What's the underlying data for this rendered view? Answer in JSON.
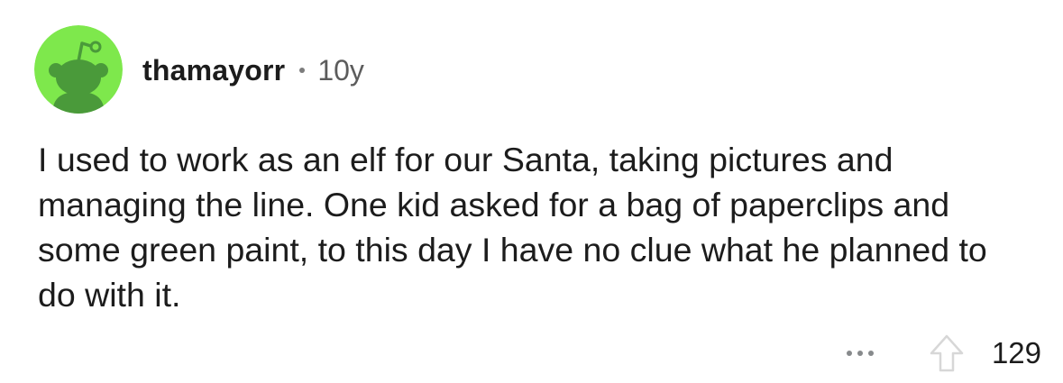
{
  "comment": {
    "username": "thamayorr",
    "age": "10y",
    "body": "I used to work as an elf for our Santa, taking pictures and managing the line. One kid asked for a bag of paperclips and some green paint, to this day I have no clue what he planned to do with it.",
    "score": "129"
  },
  "icons": {
    "avatar": "snoo-avatar-icon",
    "more": "more-options-icon",
    "upvote": "upvote-arrow-icon"
  },
  "colors": {
    "avatar_bg": "#7ee84c",
    "avatar_figure": "#4a9a3a",
    "text": "#1c1c1c",
    "muted": "#5c5c5c",
    "icon_gray": "#878a8c"
  }
}
